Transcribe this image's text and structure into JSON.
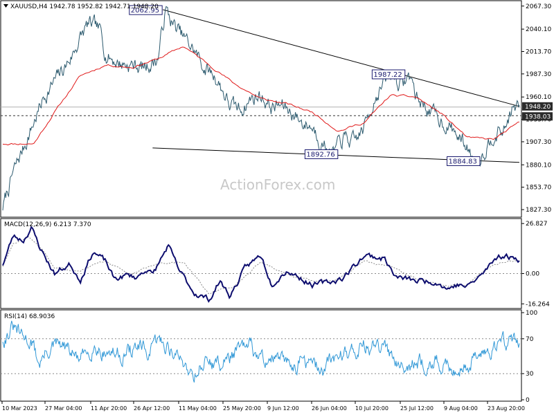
{
  "header": {
    "price_title": "XAUUSD,H4  1942.78 1952.82 1942.71 1948.20",
    "macd_title": "MACD(12,26,9) 6.213 7.370",
    "rsi_title": "RSI(14) 68.9036"
  },
  "watermark": "ActionForex.com",
  "colors": {
    "price_line": "#2c5a6e",
    "ma_line": "#e01818",
    "trend_line": "#000000",
    "macd_line": "#0d0d6e",
    "signal_line": "#8a8a8a",
    "rsi_line": "#2f97d6",
    "grid_dash": "#888888",
    "frame": "#000000",
    "annotation_border": "#1a1a6e",
    "current_price_bg": "#2b2b2b"
  },
  "chart_data": [
    {
      "id": "price",
      "type": "line",
      "symbol": "XAUUSD",
      "timeframe": "H4",
      "ylim": [
        1820,
        2072
      ],
      "y_ticks": [
        "2067.30",
        "2040.10",
        "2013.70",
        "1987.30",
        "1960.10",
        "1933.70",
        "1907.30",
        "1880.10",
        "1853.70",
        "1827.30"
      ],
      "x_ticks": [
        "10 Mar 2023",
        "27 Mar 04:00",
        "11 Apr 20:00",
        "26 Apr 12:00",
        "11 May 04:00",
        "25 May 20:00",
        "9 Jun 12:00",
        "26 Jun 04:00",
        "10 Jul 20:00",
        "25 Jul 12:00",
        "9 Aug 04:00",
        "23 Aug 20:00"
      ],
      "price_keypoints": [
        [
          0,
          1830
        ],
        [
          0.02,
          1870
        ],
        [
          0.04,
          1900
        ],
        [
          0.06,
          1930
        ],
        [
          0.08,
          1960
        ],
        [
          0.1,
          1978
        ],
        [
          0.12,
          1995
        ],
        [
          0.135,
          2010
        ],
        [
          0.15,
          2030
        ],
        [
          0.165,
          2045
        ],
        [
          0.18,
          2042
        ],
        [
          0.19,
          2035
        ],
        [
          0.2,
          2010
        ],
        [
          0.225,
          2000
        ],
        [
          0.25,
          1998
        ],
        [
          0.275,
          1995
        ],
        [
          0.3,
          2005
        ],
        [
          0.315,
          2062.95
        ],
        [
          0.33,
          2045
        ],
        [
          0.35,
          2030
        ],
        [
          0.37,
          2015
        ],
        [
          0.39,
          1995
        ],
        [
          0.41,
          1985
        ],
        [
          0.42,
          1975
        ],
        [
          0.44,
          1950
        ],
        [
          0.46,
          1945
        ],
        [
          0.48,
          1958
        ],
        [
          0.5,
          1962
        ],
        [
          0.52,
          1948
        ],
        [
          0.54,
          1950
        ],
        [
          0.56,
          1942
        ],
        [
          0.58,
          1930
        ],
        [
          0.6,
          1925
        ],
        [
          0.62,
          1905
        ],
        [
          0.64,
          1893
        ],
        [
          0.66,
          1912
        ],
        [
          0.68,
          1905
        ],
        [
          0.7,
          1925
        ],
        [
          0.72,
          1960
        ],
        [
          0.74,
          1978
        ],
        [
          0.755,
          1987.2
        ],
        [
          0.77,
          1975
        ],
        [
          0.79,
          1985
        ],
        [
          0.8,
          1960
        ],
        [
          0.82,
          1948
        ],
        [
          0.84,
          1936
        ],
        [
          0.86,
          1928
        ],
        [
          0.88,
          1915
        ],
        [
          0.9,
          1900
        ],
        [
          0.915,
          1884.83
        ],
        [
          0.93,
          1895
        ],
        [
          0.95,
          1918
        ],
        [
          0.97,
          1920
        ],
        [
          0.985,
          1945
        ],
        [
          1,
          1948.2
        ]
      ],
      "ma_keypoints": [
        [
          0.06,
          1905
        ],
        [
          0.1,
          1942
        ],
        [
          0.15,
          1985
        ],
        [
          0.2,
          1998
        ],
        [
          0.25,
          1995
        ],
        [
          0.3,
          2005
        ],
        [
          0.35,
          2020
        ],
        [
          0.4,
          1998
        ],
        [
          0.45,
          1975
        ],
        [
          0.5,
          1958
        ],
        [
          0.55,
          1952
        ],
        [
          0.6,
          1942
        ],
        [
          0.65,
          1920
        ],
        [
          0.7,
          1930
        ],
        [
          0.75,
          1962
        ],
        [
          0.8,
          1960
        ],
        [
          0.85,
          1940
        ],
        [
          0.9,
          1912
        ],
        [
          0.95,
          1910
        ],
        [
          1,
          1930
        ]
      ],
      "trend_lines": [
        {
          "from": [
            0.31,
            2063
          ],
          "to": [
            1.0,
            1949
          ]
        },
        {
          "from": [
            0.29,
            1900
          ],
          "to": [
            1.0,
            1883
          ]
        }
      ],
      "horizontal_dashed_level": 1938.03,
      "horizontal_solid_level": 1948.2,
      "annotations": [
        {
          "label": "2062.95",
          "x": 0.245,
          "y": 2062.95,
          "align": "left"
        },
        {
          "label": "1987.22",
          "x": 0.715,
          "y": 1987.2,
          "align": "left"
        },
        {
          "label": "1892.76",
          "x": 0.585,
          "y": 1893,
          "align": "left"
        },
        {
          "label": "1884.83",
          "x": 0.86,
          "y": 1884.83,
          "align": "left"
        }
      ],
      "current_price_labels": [
        "1948.20",
        "1938.03"
      ]
    },
    {
      "id": "macd",
      "type": "line",
      "title": "MACD(12,26,9)",
      "values": {
        "macd": 6.213,
        "signal": 7.37
      },
      "ylim": [
        -18,
        28
      ],
      "y_ticks": [
        "26.827",
        "0.00",
        "-16.264"
      ],
      "zero_line": 0,
      "macd_keypoints": [
        [
          0,
          5
        ],
        [
          0.02,
          20
        ],
        [
          0.04,
          18
        ],
        [
          0.055,
          25
        ],
        [
          0.07,
          15
        ],
        [
          0.09,
          5
        ],
        [
          0.1,
          0
        ],
        [
          0.13,
          5
        ],
        [
          0.15,
          -3
        ],
        [
          0.175,
          12
        ],
        [
          0.2,
          6
        ],
        [
          0.215,
          -3
        ],
        [
          0.24,
          -1
        ],
        [
          0.26,
          -2
        ],
        [
          0.28,
          3
        ],
        [
          0.29,
          -1
        ],
        [
          0.32,
          15
        ],
        [
          0.34,
          2
        ],
        [
          0.37,
          -10
        ],
        [
          0.4,
          -14
        ],
        [
          0.42,
          -4
        ],
        [
          0.44,
          -12
        ],
        [
          0.47,
          3
        ],
        [
          0.5,
          10
        ],
        [
          0.52,
          -5
        ],
        [
          0.55,
          2
        ],
        [
          0.6,
          -6
        ],
        [
          0.63,
          -5
        ],
        [
          0.66,
          -2
        ],
        [
          0.7,
          10
        ],
        [
          0.74,
          8
        ],
        [
          0.76,
          -2
        ],
        [
          0.8,
          -4
        ],
        [
          0.84,
          -4
        ],
        [
          0.86,
          -8
        ],
        [
          0.88,
          -6
        ],
        [
          0.9,
          -7
        ],
        [
          0.93,
          0
        ],
        [
          0.96,
          10
        ],
        [
          1,
          8
        ]
      ],
      "signal_keypoints": [
        [
          0,
          4
        ],
        [
          0.02,
          16
        ],
        [
          0.05,
          20
        ],
        [
          0.08,
          12
        ],
        [
          0.1,
          3
        ],
        [
          0.15,
          2
        ],
        [
          0.2,
          7
        ],
        [
          0.25,
          -1
        ],
        [
          0.3,
          6
        ],
        [
          0.35,
          6
        ],
        [
          0.4,
          -11
        ],
        [
          0.45,
          -6
        ],
        [
          0.5,
          6
        ],
        [
          0.55,
          0
        ],
        [
          0.6,
          -4
        ],
        [
          0.65,
          -3
        ],
        [
          0.7,
          6
        ],
        [
          0.75,
          4
        ],
        [
          0.8,
          -3
        ],
        [
          0.85,
          -6
        ],
        [
          0.9,
          -6
        ],
        [
          0.95,
          5
        ],
        [
          1,
          7
        ]
      ]
    },
    {
      "id": "rsi",
      "type": "line",
      "title": "RSI(14)",
      "values": {
        "rsi": 68.9036
      },
      "ylim": [
        0,
        100
      ],
      "y_ticks": [
        "100",
        "70",
        "30",
        "0"
      ],
      "levels": [
        70,
        30
      ],
      "rsi_keypoints": [
        [
          0,
          70
        ],
        [
          0.02,
          82
        ],
        [
          0.04,
          70
        ],
        [
          0.055,
          68
        ],
        [
          0.07,
          42
        ],
        [
          0.09,
          58
        ],
        [
          0.11,
          62
        ],
        [
          0.13,
          55
        ],
        [
          0.15,
          45
        ],
        [
          0.175,
          62
        ],
        [
          0.2,
          55
        ],
        [
          0.23,
          52
        ],
        [
          0.26,
          60
        ],
        [
          0.285,
          52
        ],
        [
          0.3,
          68
        ],
        [
          0.32,
          62
        ],
        [
          0.34,
          48
        ],
        [
          0.37,
          30
        ],
        [
          0.39,
          45
        ],
        [
          0.42,
          40
        ],
        [
          0.45,
          55
        ],
        [
          0.48,
          60
        ],
        [
          0.5,
          45
        ],
        [
          0.52,
          50
        ],
        [
          0.55,
          40
        ],
        [
          0.58,
          45
        ],
        [
          0.6,
          38
        ],
        [
          0.62,
          35
        ],
        [
          0.65,
          52
        ],
        [
          0.68,
          58
        ],
        [
          0.7,
          62
        ],
        [
          0.72,
          60
        ],
        [
          0.75,
          54
        ],
        [
          0.77,
          45
        ],
        [
          0.8,
          40
        ],
        [
          0.83,
          45
        ],
        [
          0.86,
          35
        ],
        [
          0.88,
          38
        ],
        [
          0.9,
          40
        ],
        [
          0.93,
          55
        ],
        [
          0.96,
          66
        ],
        [
          1,
          69
        ]
      ]
    }
  ]
}
